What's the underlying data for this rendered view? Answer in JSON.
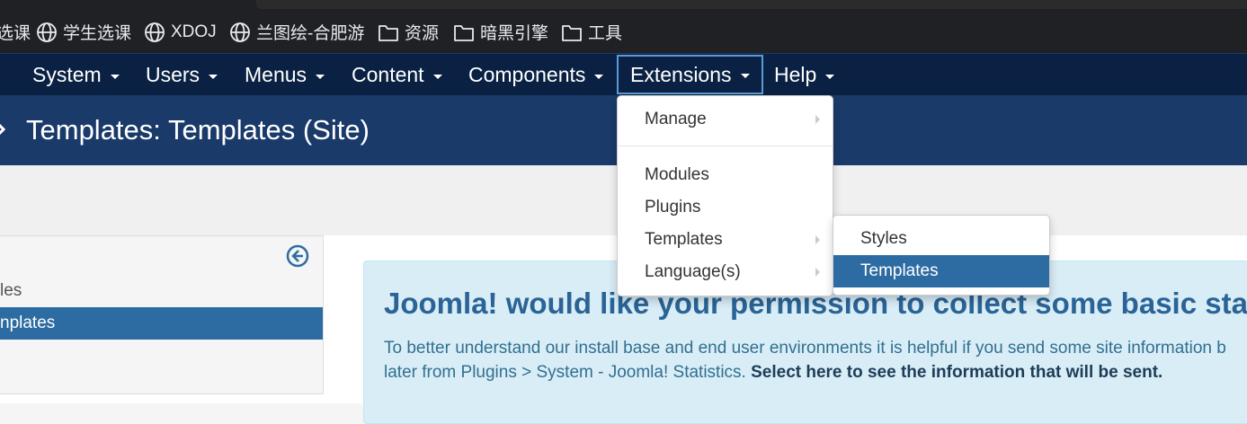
{
  "browser": {
    "bookmarks": [
      {
        "label": "选课",
        "icon": "globe-icon"
      },
      {
        "label": "学生选课",
        "icon": "globe-icon"
      },
      {
        "label": "XDOJ",
        "icon": "globe-icon"
      },
      {
        "label": "兰图绘-合肥游",
        "icon": "globe-icon"
      },
      {
        "label": "资源",
        "icon": "folder-icon"
      },
      {
        "label": "暗黑引擎",
        "icon": "folder-icon"
      },
      {
        "label": "工具",
        "icon": "folder-icon"
      }
    ]
  },
  "navbar": {
    "items": [
      "System",
      "Users",
      "Menus",
      "Content",
      "Components",
      "Extensions",
      "Help"
    ],
    "active": "Extensions"
  },
  "page": {
    "title": "Templates: Templates (Site)"
  },
  "sidebar": {
    "items": [
      {
        "label": "les",
        "active": false
      },
      {
        "label": "nplates",
        "active": true
      }
    ]
  },
  "stats": {
    "title": "Joomla! would like your permission to collect some basic sta",
    "line1": "To better understand our install base and end user environments it is helpful if you send some site information b",
    "line2": "later from Plugins > System - Joomla! Statistics. ",
    "line2_bold": "Select here to see the information that will be sent."
  },
  "extensions_menu": {
    "manage": "Manage",
    "items": [
      "Modules",
      "Plugins",
      "Templates",
      "Language(s)"
    ]
  },
  "templates_submenu": {
    "items": [
      "Styles",
      "Templates"
    ],
    "active": "Templates"
  },
  "colors": {
    "navbar_bg": "#0a2143",
    "title_bg": "#1a3a6a",
    "active_blue": "#2d6ca2",
    "stats_bg": "#d9edf7"
  }
}
